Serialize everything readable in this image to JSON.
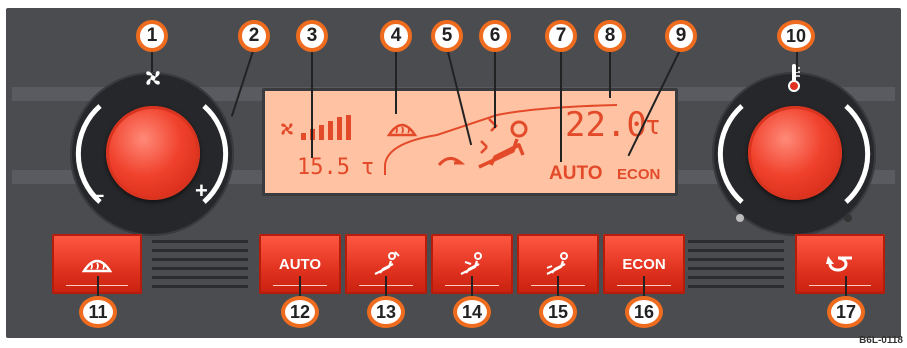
{
  "callouts": [
    "1",
    "2",
    "3",
    "4",
    "5",
    "6",
    "7",
    "8",
    "9",
    "10",
    "11",
    "12",
    "13",
    "14",
    "15",
    "16",
    "17"
  ],
  "lcd": {
    "inner_temp": "15.5",
    "inner_unit": "τ",
    "set_temp": "22.0",
    "set_unit": "τ",
    "auto": "AUTO",
    "econ": "ECON"
  },
  "left_knob": {
    "minus": "–",
    "plus": "+"
  },
  "buttons": {
    "auto": "AUTO",
    "econ": "ECON"
  },
  "image_code": "B6L-0118",
  "colors": {
    "panel": "#4b4c50",
    "button_red": "#e0321f",
    "lcd_bg": "#ffc3a3",
    "lcd_text": "#e34a2a",
    "callout_ring": "#ef6c1f"
  },
  "icons": {
    "fan": "fan-icon",
    "temperature": "thermometer-icon",
    "windshield": "windshield-defrost-icon",
    "recirc": "recirculation-icon",
    "seat": "seat-airflow-icon"
  }
}
